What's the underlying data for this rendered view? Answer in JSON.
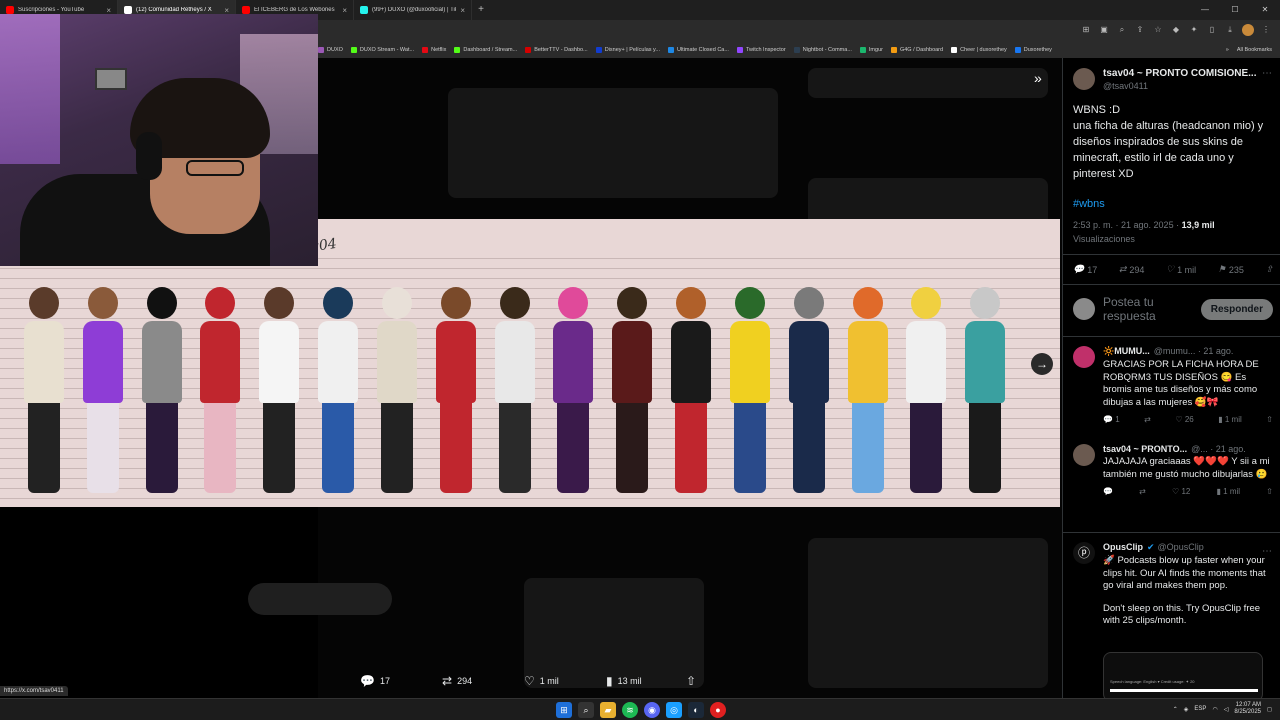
{
  "browser": {
    "tabs": [
      {
        "title": "Suscripciones - YouTube",
        "color": "#ff0000",
        "active": false
      },
      {
        "title": "(12) Comunidad Retheys / X",
        "color": "#ffffff",
        "active": true
      },
      {
        "title": "El ICEBERG de Los Webones",
        "color": "#ff0000",
        "active": false
      },
      {
        "title": "(99+) DUXO (@duxooficial) | TikTok",
        "color": "#25f4ee",
        "active": false
      }
    ],
    "new_tab": "+",
    "bookmarks": [
      {
        "label": "DUXO",
        "color": "#9b59b6"
      },
      {
        "label": "DUXO Stream - Wat...",
        "color": "#53fc18"
      },
      {
        "label": "Netflix",
        "color": "#e50914"
      },
      {
        "label": "Dashboard / Stream...",
        "color": "#53fc18"
      },
      {
        "label": "BetterTTV - Dashbo...",
        "color": "#d50000"
      },
      {
        "label": "Disney+ | Películas y...",
        "color": "#113ccf"
      },
      {
        "label": "Ultimate Closed Ca...",
        "color": "#1e88e5"
      },
      {
        "label": "Twitch Inspector",
        "color": "#9146ff"
      },
      {
        "label": "Nightbot - Comma...",
        "color": "#2c3e50"
      },
      {
        "label": "Imgur",
        "color": "#1bb76e"
      },
      {
        "label": "G4G / Dashboard",
        "color": "#f39c12"
      },
      {
        "label": "Cheer | duxorethey",
        "color": "#ffffff"
      },
      {
        "label": "Duxorethey",
        "color": "#1877f2"
      }
    ],
    "all_bookmarks": "All Bookmarks"
  },
  "art": {
    "signature": "tsav04",
    "characters": [
      {
        "hair": "#5a3b2a",
        "top": "#e8e0d0",
        "legs": "#222222"
      },
      {
        "hair": "#8a5a3a",
        "top": "#8e3dd6",
        "legs": "#e8e0e8"
      },
      {
        "hair": "#111111",
        "top": "#8a8a8a",
        "legs": "#2a1a3a"
      },
      {
        "hair": "#c0262e",
        "top": "#c0262e",
        "legs": "#e8b6c2"
      },
      {
        "hair": "#5a3a2a",
        "top": "#f5f5f5",
        "legs": "#222222"
      },
      {
        "hair": "#1a3a5a",
        "top": "#f0f0f0",
        "legs": "#2a5aa8"
      },
      {
        "hair": "#e8e0d8",
        "top": "#e0d8c8",
        "legs": "#222222"
      },
      {
        "hair": "#7a4a2a",
        "top": "#c0262e",
        "legs": "#c0262e"
      },
      {
        "hair": "#3a2a1a",
        "top": "#e8e8e8",
        "legs": "#2a2a2a"
      },
      {
        "hair": "#e04a9a",
        "top": "#6a2a8a",
        "legs": "#3a1a4a"
      },
      {
        "hair": "#3a2a1a",
        "top": "#5a1a1a",
        "legs": "#2a1a1a"
      },
      {
        "hair": "#b0602a",
        "top": "#1a1a1a",
        "legs": "#c0262e"
      },
      {
        "hair": "#2a6a2a",
        "top": "#f0d020",
        "legs": "#2a4a8a"
      },
      {
        "hair": "#7a7a7a",
        "top": "#1a2a4a",
        "legs": "#1a2a4a"
      },
      {
        "hair": "#e06a2a",
        "top": "#f0c030",
        "legs": "#6aa8e0"
      },
      {
        "hair": "#f0d040",
        "top": "#f0f0f0",
        "legs": "#2a1a3a"
      },
      {
        "hair": "#c8c8c8",
        "top": "#3aa0a0",
        "legs": "#1a1a1a"
      }
    ]
  },
  "media_actions": {
    "replies": "17",
    "reposts": "294",
    "likes": "1 mil",
    "views": "13 mil"
  },
  "post": {
    "author": "tsav04 ~ PRONTO COMISIONE...",
    "handle": "@tsav0411",
    "text_line1": "WBNS :D",
    "text_body": "una ficha de alturas (headcanon mio) y diseños inspirados de sus skins de minecraft, estilo irl de cada uno y pinterest XD",
    "hashtag": "#wbns",
    "time": "2:53 p. m. · 21 ago. 2025 · ",
    "views_count": "13,9 mil",
    "views_label": "Visualizaciones",
    "stats": {
      "replies": "17",
      "reposts": "294",
      "likes": "1 mil",
      "bookmarks": "235"
    },
    "reply_placeholder": "Postea tu respuesta",
    "reply_button": "Responder"
  },
  "replies": [
    {
      "name": "🔆MUMU...",
      "handle": "@mumu... · 21 ago.",
      "text": "GRACIAS POR LA FICHA HORA DE ROBQRM3 TUS DISEÑOS 😋 Es bromis ame tus diseños y más como dibujas a las mujeres 🥰🎀",
      "replies": "1",
      "likes": "26",
      "views": "1 mil",
      "avatar_color": "#c0306a"
    },
    {
      "name": "tsav04 ~ PRONTO...",
      "handle": "@... · 21 ago.",
      "text": "JAJAJAJA graciaaas ❤️❤️❤️ Y sii a mi también me gustó mucho dibujarlas 🥲",
      "replies": "",
      "likes": "12",
      "views": "1 mil",
      "avatar_color": "#6b5a50"
    }
  ],
  "ad": {
    "name": "OpusClip",
    "handle": "@OpusClip",
    "text1": "🚀 Podcasts blow up faster when your clips hit. Our AI finds the moments that go viral and makes them pop.",
    "text2": "Don't sleep on this. Try OpusClip free with 25 clips/month.",
    "preview_text": "Speech language: English ▾     Credit usage: ✦ 20"
  },
  "status_url": "https://x.com/tsav0411",
  "taskbar": {
    "lang": "ESP",
    "time": "12:07 AM",
    "date": "8/25/2025"
  },
  "colors": {
    "accent": "#1d9bf0",
    "muted": "#71767b"
  }
}
